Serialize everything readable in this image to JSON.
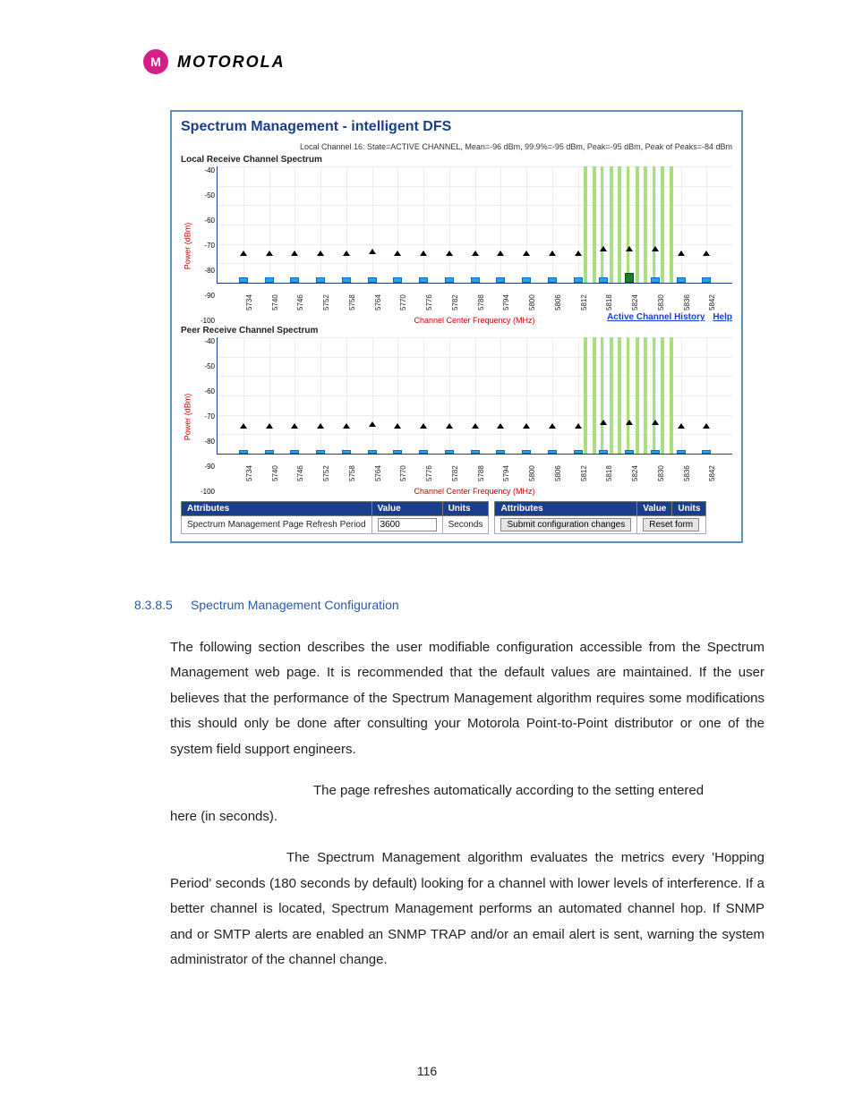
{
  "logo": {
    "mark": "M",
    "wordmark": "MOTOROLA"
  },
  "panel": {
    "title": "Spectrum Management - intelligent DFS",
    "status": "Local Channel 16: State=ACTIVE CHANNEL, Mean=-96 dBm, 99.9%=-95 dBm, Peak=-95 dBm, Peak of Peaks=-84 dBm",
    "local_title": "Local Receive Channel Spectrum",
    "peer_title": "Peer Receive Channel Spectrum",
    "ylabel": "Power (dBm)",
    "xlabel": "Channel Center Frequency (MHz)",
    "links": {
      "history": "Active Channel History",
      "help": "Help"
    },
    "attr": {
      "headers_left": [
        "Attributes",
        "Value",
        "Units"
      ],
      "headers_right": [
        "Attributes",
        "Value",
        "Units"
      ],
      "refresh_label": "Spectrum Management Page Refresh Period",
      "refresh_value": "3600",
      "refresh_units": "Seconds",
      "submit": "Submit configuration changes",
      "reset": "Reset form"
    }
  },
  "chart_data": {
    "type": "bar",
    "ylabel": "Power (dBm)",
    "xlabel": "Channel Center Frequency (MHz)",
    "ylim": [
      -100,
      -40
    ],
    "yticks": [
      -40,
      -50,
      -60,
      -70,
      -80,
      -90,
      -100
    ],
    "categories": [
      5734,
      5740,
      5746,
      5752,
      5758,
      5764,
      5770,
      5776,
      5782,
      5788,
      5794,
      5800,
      5806,
      5812,
      5818,
      5824,
      5830,
      5836,
      5842
    ],
    "active_band": {
      "start": 5814,
      "end": 5834
    },
    "series": [
      {
        "name": "Local Receive Channel Spectrum",
        "bars": [
          -97,
          -97,
          -97,
          -97,
          -97,
          -97,
          -97,
          -97,
          -97,
          -97,
          -97,
          -97,
          -97,
          -97,
          -97,
          -95,
          -97,
          -97,
          -97
        ],
        "peaks": [
          -86,
          -86,
          -86,
          -86,
          -86,
          -85,
          -86,
          -86,
          -86,
          -86,
          -86,
          -86,
          -86,
          -86,
          -84,
          -84,
          -84,
          -86,
          -86
        ]
      },
      {
        "name": "Peer Receive Channel Spectrum",
        "bars": [
          -98,
          -98,
          -98,
          -98,
          -98,
          -98,
          -98,
          -98,
          -98,
          -98,
          -98,
          -98,
          -98,
          -98,
          -98,
          -98,
          -98,
          -98,
          -98
        ],
        "peaks": [
          -87,
          -87,
          -87,
          -87,
          -87,
          -86,
          -87,
          -87,
          -87,
          -87,
          -87,
          -87,
          -87,
          -87,
          -85,
          -85,
          -85,
          -87,
          -87
        ]
      }
    ]
  },
  "section": {
    "number": "8.3.8.5",
    "title": "Spectrum Management Configuration",
    "p1": "The following section describes the user modifiable configuration accessible from the Spectrum Management web page. It is recommended that the default values are maintained. If the user believes that the performance of the Spectrum Management algorithm requires some modifications this should only be done after consulting your Motorola Point-to-Point distributor or one of the system field support engineers.",
    "p2a": "The page refreshes automatically according to the setting entered",
    "p2b": "here (in seconds).",
    "p3a": "The Spectrum Management algorithm evaluates the metrics every",
    "p3b": "'Hopping Period' seconds (180 seconds by default) looking for a channel with lower levels of interference. If a better channel is located, Spectrum Management performs an automated channel hop. If SNMP and or SMTP alerts are enabled an SNMP TRAP and/or an email alert is sent, warning the system administrator of the channel change."
  },
  "page_number": "116"
}
